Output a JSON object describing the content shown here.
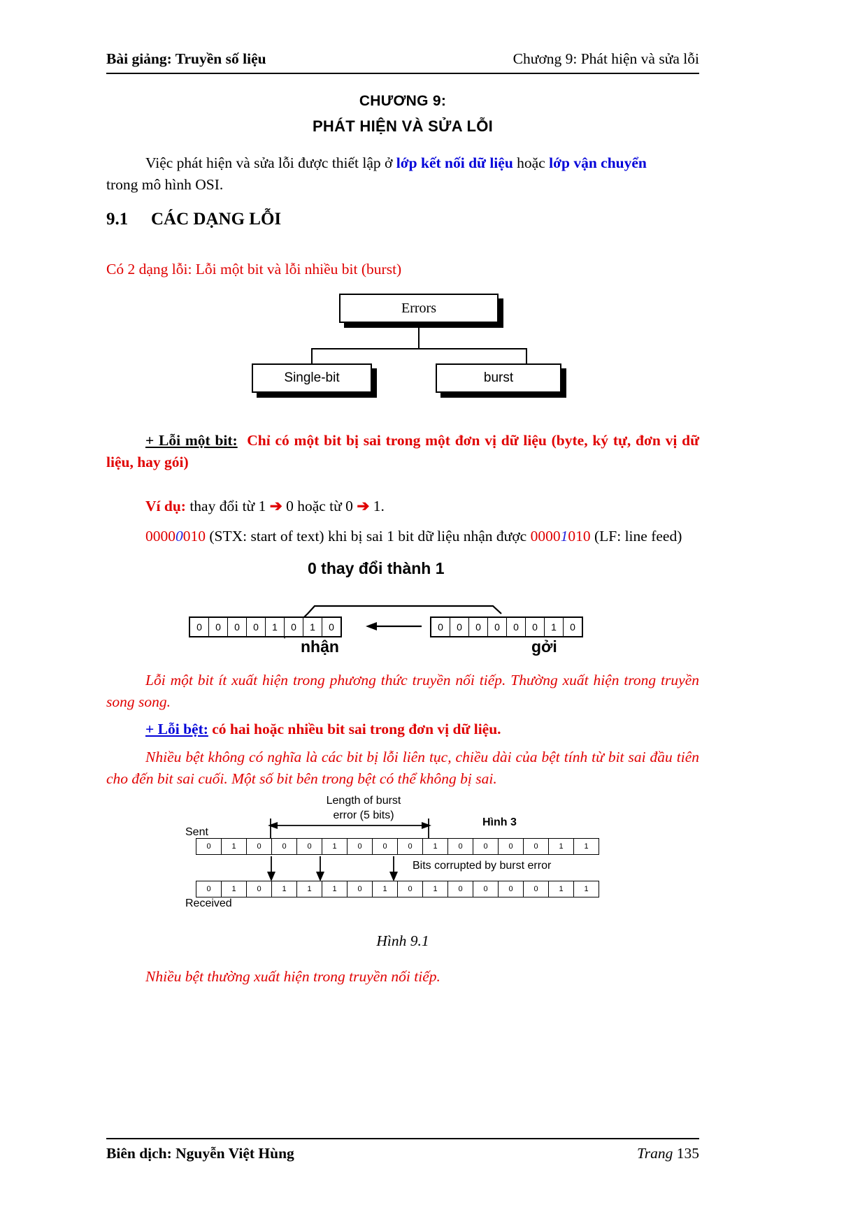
{
  "header": {
    "left": "Bài giảng: Truyền số liệu",
    "right": "Chương 9: Phát hiện và sửa lỗi"
  },
  "title": {
    "line1": "CHƯƠNG 9:",
    "line2": "PHÁT HIỆN VÀ SỬA LỖI"
  },
  "intro": {
    "t1": "Việc phát hiện và sửa lỗi được thiết lập ở ",
    "link1": "lớp kết nối dữ liệu",
    "t2": " hoặc ",
    "link2": "lớp vận chuyển",
    "t3": "trong mô hình OSI."
  },
  "section": {
    "number": "9.1",
    "heading": "CÁC DẠNG LỖI"
  },
  "error_types_line": "Có 2 dạng lỗi: Lỗi một bit và lỗi nhiều bit (burst)",
  "tree": {
    "root": "Errors",
    "child_left": "Single-bit",
    "child_right": "burst"
  },
  "single_bit": {
    "label": "+ Lỗi một bit:",
    "definition": "Chỉ có một bit bị sai trong một đơn vị dữ liệu (byte, ký tự, đơn vị dữ liệu, hay gói)",
    "example_label": "Ví dụ:",
    "example_text_a": " thay đổi từ 1 ",
    "arrow": "➔",
    "example_text_b": " 0 hoặc từ 0 ",
    "example_text_c": " 1.",
    "stx_prefix": "0000",
    "stx_highlight": "0",
    "stx_suffix": "010",
    "mid_text_a": " (STX: start of text) khi bị sai 1 bit dữ liệu nhận được ",
    "lf_prefix": "0000",
    "lf_highlight": "1",
    "lf_suffix": "010",
    "mid_text_b": " (LF: line feed)"
  },
  "fig_bit": {
    "caption": "0 thay đổi thành 1",
    "received_bits": [
      "0",
      "0",
      "0",
      "0",
      "1",
      "0",
      "1",
      "0"
    ],
    "sent_bits": [
      "0",
      "0",
      "0",
      "0",
      "0",
      "0",
      "1",
      "0"
    ],
    "received_label": "nhận",
    "sent_label": "gởi"
  },
  "note_italic_1": "Lỗi một bit ít xuất hiện trong phương thức truyền nối tiếp. Thường xuất hiện trong truyền song song.",
  "burst": {
    "label": "+ Lỗi bệt:",
    "definition": "có hai hoặc nhiều bit sai trong đơn vị dữ liệu.",
    "paragraph": "Nhiều bệt không có nghĩa là các bit bị lỗi liên tục, chiều dài của bệt tính từ bit sai đầu tiên cho đến bit sai cuối. Một số bit bên trong bệt có thể không bị sai."
  },
  "fig_burst": {
    "length_label_l1": "Length of burst",
    "length_label_l2": "error (5 bits)",
    "hinh3": "Hình 3",
    "sent_label": "Sent",
    "received_label": "Received",
    "corrupted_label": "Bits corrupted by burst error",
    "sent_bits": [
      "0",
      "1",
      "0",
      "0",
      "0",
      "1",
      "0",
      "0",
      "0",
      "1",
      "0",
      "0",
      "0",
      "0",
      "1",
      "1"
    ],
    "received_bits": [
      "0",
      "1",
      "0",
      "1",
      "1",
      "1",
      "0",
      "1",
      "0",
      "1",
      "0",
      "0",
      "0",
      "0",
      "1",
      "1"
    ],
    "caption": "Hình 9.1"
  },
  "note_italic_2": "Nhiều bệt thường xuất hiện trong truyền nối tiếp.",
  "footer": {
    "left": "Biên dịch: Nguyễn Việt Hùng",
    "right_label": "Trang",
    "right_page": "135"
  },
  "colors": {
    "red": "#e00000",
    "blue": "#0000d8",
    "black": "#000000"
  }
}
